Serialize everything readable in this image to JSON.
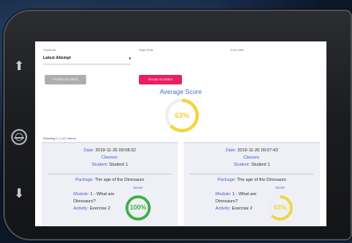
{
  "filters": {
    "label_1": "Students",
    "label_2": "Start Date",
    "label_3": "End Date",
    "select_value": "Latest Attempt"
  },
  "buttons": {
    "left_label": "FILTER SCORES",
    "right_label": "SHOW SCORES"
  },
  "average": {
    "title": "Average Score",
    "label": "63%",
    "percent": 63,
    "color": "#f4d43a"
  },
  "showing": "Showing 1-1 of 1 items.",
  "cards": [
    {
      "date_label": "Date:",
      "date_value": "2019-11-26 09:08:32",
      "classes_label": "Classes:",
      "student_label": "Student:",
      "student_value": "Student 1",
      "package_label": "Package:",
      "package_value": "The age of the Dinosaurs",
      "module_label": "Module:",
      "module_value": "1 - What are Dinosaurs?",
      "activity_label": "Activity:",
      "activity_value": "Exercise 2",
      "score_label": "Score",
      "score_text": "100%",
      "score_percent": 100,
      "score_color": "#3cb043"
    },
    {
      "date_label": "Date:",
      "date_value": "2019-11-26 09:07:43",
      "classes_label": "Classes:",
      "student_label": "Student:",
      "student_value": "Student 1",
      "package_label": "Package:",
      "package_value": "The age of the Dinosaurs",
      "module_label": "Module:",
      "module_value": "1 - What are Dinosaurs?",
      "activity_label": "Activity:",
      "activity_value": "Exercise 2",
      "score_label": "Score",
      "score_text": "63%",
      "score_percent": 63,
      "score_color": "#f4d43a"
    }
  ]
}
